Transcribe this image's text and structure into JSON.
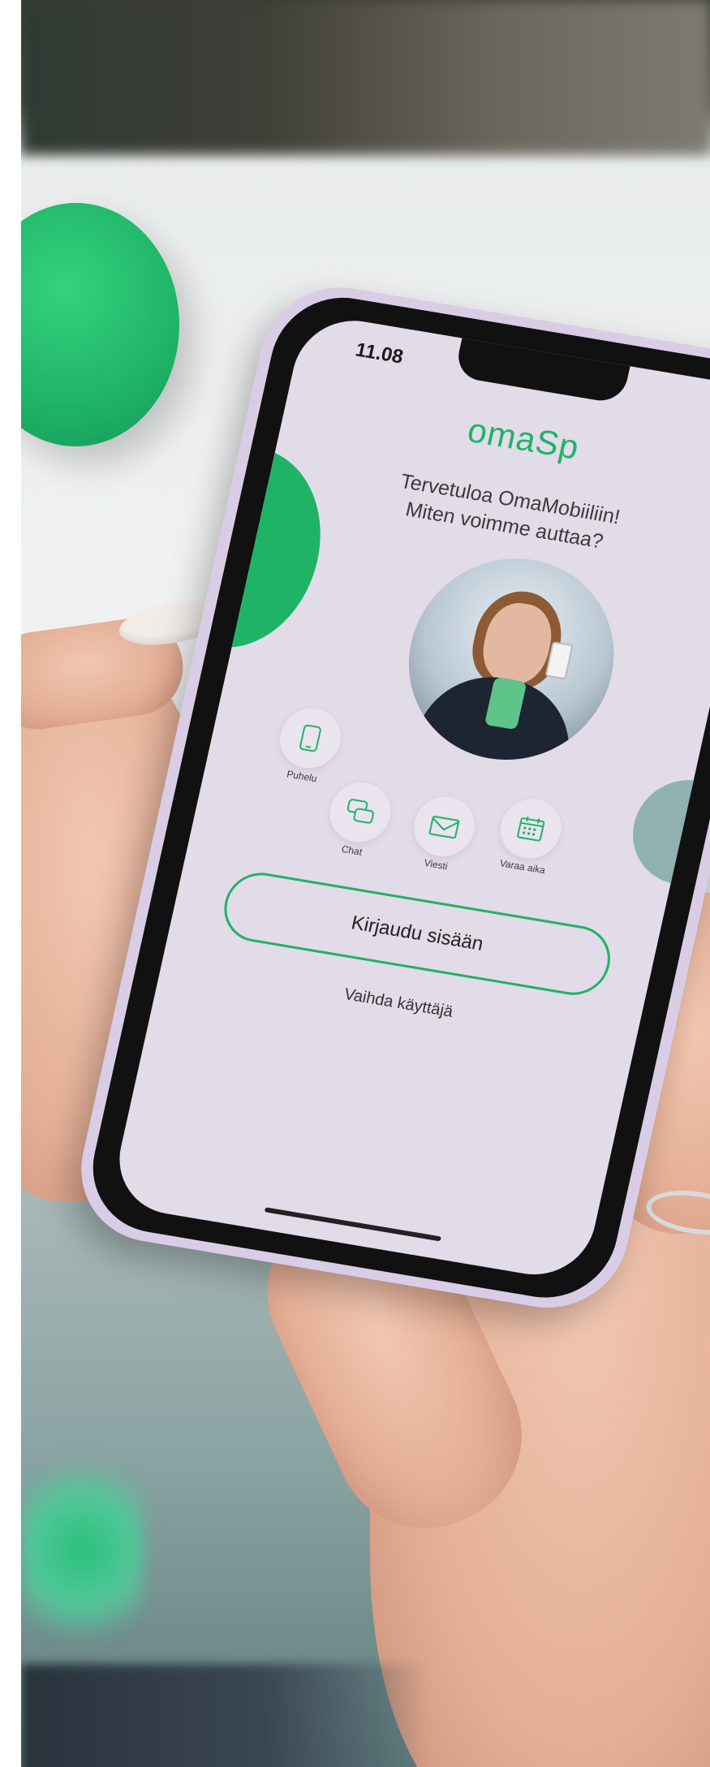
{
  "status_bar": {
    "time": "11.08"
  },
  "app": {
    "logo": "omaSp",
    "welcome_line1": "Tervetuloa OmaMobiiliin!",
    "welcome_line2": "Miten voimme auttaa?"
  },
  "actions": [
    {
      "label": "Puhelu",
      "icon": "phone-icon"
    },
    {
      "label": "Chat",
      "icon": "chat-bubbles-icon"
    },
    {
      "label": "Viesti",
      "icon": "envelope-icon"
    },
    {
      "label": "Varaa aika",
      "icon": "calendar-icon"
    }
  ],
  "buttons": {
    "login": "Kirjaudu sisään",
    "switch_user": "Vaihda käyttäjä"
  },
  "colors": {
    "brand_green": "#1fb366",
    "screen_bg": "#e2dbe8",
    "case_lilac": "#d9cde6"
  }
}
